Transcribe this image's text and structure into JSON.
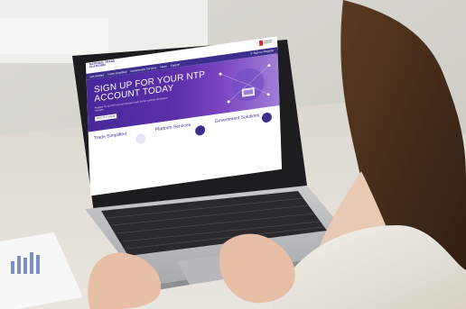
{
  "site": {
    "logo_text": "NATIONAL TRADE PLATFORM",
    "nav_items": [
      "Get Started",
      "Trade Simplified",
      "Government Services",
      "News",
      "Support"
    ],
    "signin_label": "Sign in / Register"
  },
  "hero": {
    "title": "SIGN UP FOR YOUR NTP ACCOUNT TODAY",
    "subtitle": "Register for an NTP account and get ready for the customs declaration changes.",
    "button_label": "FIND OUT MORE"
  },
  "cards": [
    {
      "title": "Trade Simplified"
    },
    {
      "title": "Platform Services"
    },
    {
      "title": "Government Solutions"
    }
  ],
  "colors": {
    "brand_purple": "#3c2e8c",
    "hero_start": "#46289a",
    "hero_end": "#9f7fd8",
    "accent_red": "#d9262c"
  }
}
